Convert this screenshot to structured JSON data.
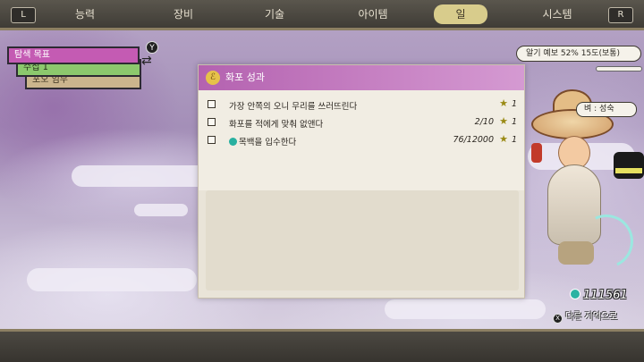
{
  "nav": {
    "left_button": "L",
    "right_button": "R",
    "tabs": [
      {
        "label": "능력"
      },
      {
        "label": "장비"
      },
      {
        "label": "기술"
      },
      {
        "label": "아이템"
      },
      {
        "label": "일",
        "active": true
      },
      {
        "label": "시스템"
      }
    ]
  },
  "quest_list": {
    "items": [
      {
        "label": "탐색 목표"
      },
      {
        "label": "수집 1"
      },
      {
        "label": "포오 임무"
      }
    ],
    "y_button": "Y"
  },
  "panel": {
    "title": "화포 성과",
    "rows": [
      {
        "text": "가장 안쪽의 오니 무리를 쓰러뜨린다",
        "progress": "",
        "reward": "1"
      },
      {
        "text": "화포를 적에게 맞춰 없앤다",
        "progress": "2/10",
        "reward": "1"
      },
      {
        "text": "목백을 입수한다",
        "progress": "76/12000",
        "reward": "1",
        "gem": true
      }
    ]
  },
  "status": {
    "weather": "알기 예보 52% 15도(보통)",
    "season": "벼 : 성숙",
    "money": "111561",
    "goto_label": "다른 지역으로",
    "goto_button": "X"
  },
  "colors": {
    "accent_purple": "#c45bb3",
    "green_tab": "#8cc86d",
    "tan_tab": "#cbb58d",
    "active_tab": "#d8cc8c"
  }
}
